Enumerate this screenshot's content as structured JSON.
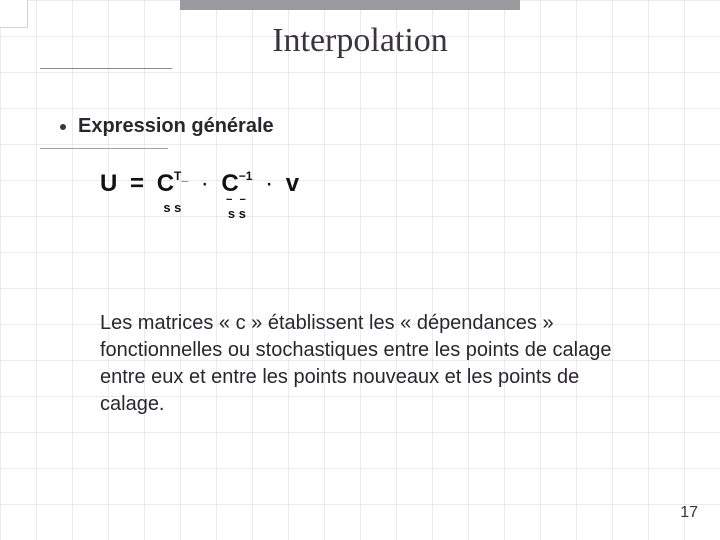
{
  "title": "Interpolation",
  "section": "Expression générale",
  "equation": {
    "lhs": "U",
    "eq": "=",
    "c1": {
      "base": "C",
      "sup": "T_",
      "sub": "s s"
    },
    "dot": "·",
    "c2": {
      "base": "C",
      "sup": "−1",
      "under": "− −",
      "sub": "s s"
    },
    "v": "v"
  },
  "body": "Les matrices « c » établissent les « dépendances » fonctionnelles ou stochastiques entre les points de calage entre eux et entre les points nouveaux et les points de calage.",
  "page_number": "17"
}
